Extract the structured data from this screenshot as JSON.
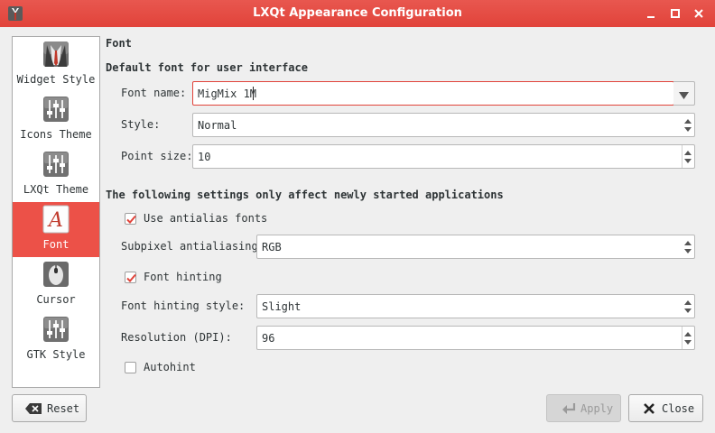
{
  "window": {
    "title": "LXQt Appearance Configuration"
  },
  "sidebar": {
    "items": [
      {
        "label": "Widget Style",
        "icon": "suit-icon"
      },
      {
        "label": "Icons Theme",
        "icon": "sliders-icon"
      },
      {
        "label": "LXQt Theme",
        "icon": "sliders-icon"
      },
      {
        "label": "Font",
        "icon": "font-icon",
        "selected": true
      },
      {
        "label": "Cursor",
        "icon": "mouse-icon"
      },
      {
        "label": "GTK Style",
        "icon": "sliders-icon"
      }
    ]
  },
  "page": {
    "title": "Font",
    "section_default": "Default font for user interface",
    "font_name_label": "Font name:",
    "font_name_value": "MigMix 1M",
    "style_label": "Style:",
    "style_value": "Normal",
    "point_size_label": "Point size:",
    "point_size_value": "10",
    "section_new_apps": "The following settings only affect newly started applications",
    "antialias_label": "Use antialias fonts",
    "antialias_checked": true,
    "subpixel_label": "Subpixel antialiasing:",
    "subpixel_value": "RGB",
    "hinting_label": "Font hinting",
    "hinting_checked": true,
    "hinting_style_label": "Font hinting style:",
    "hinting_style_value": "Slight",
    "dpi_label": "Resolution (DPI):",
    "dpi_value": "96",
    "autohint_label": "Autohint",
    "autohint_checked": false
  },
  "buttons": {
    "reset": "Reset",
    "apply": "Apply",
    "close": "Close"
  },
  "colors": {
    "accent": "#e1433a",
    "selection": "#ec5148"
  }
}
